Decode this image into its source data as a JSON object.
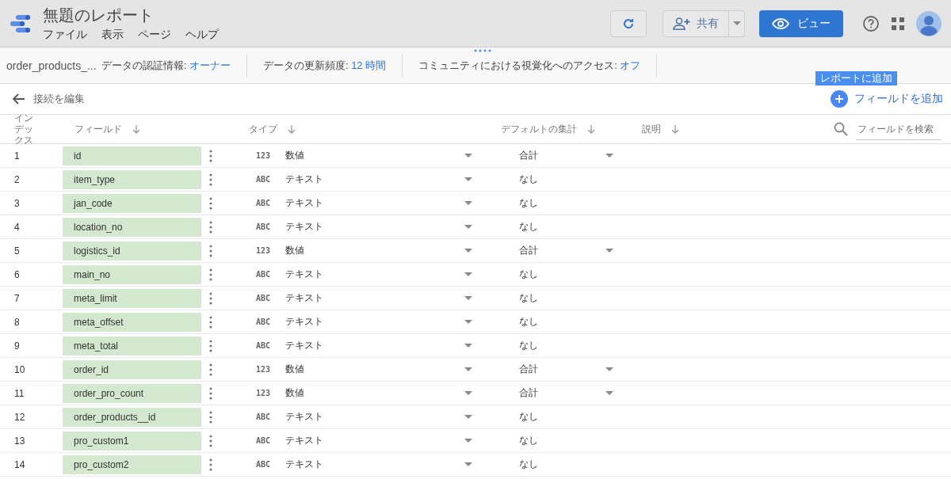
{
  "header": {
    "title": "無題のレポート",
    "menu": [
      "ファイル",
      "表示",
      "ページ",
      "ヘルプ"
    ],
    "share_label": "共有",
    "view_label": "ビュー"
  },
  "info_bar": {
    "source": "order_products_...",
    "items": [
      {
        "label": "データの認証情報:",
        "value": "オーナー"
      },
      {
        "label": "データの更新頻度:",
        "value": "12 時間"
      },
      {
        "label": "コミュニティにおける視覚化へのアクセス:",
        "value": "オフ"
      }
    ]
  },
  "tooltip": "レポートに追加",
  "edit_bar": {
    "back_label": "接続を編集",
    "add_field_label": "フィールドを追加"
  },
  "table": {
    "columns": [
      "インデックス",
      "フィールド",
      "タイプ",
      "デフォルトの集計",
      "説明"
    ],
    "search_placeholder": "フィールドを検索",
    "rows": [
      {
        "index": "1",
        "field": "id",
        "type_icon": "123",
        "type": "数値",
        "aggregation": "合計",
        "aggregation_menu": true
      },
      {
        "index": "2",
        "field": "item_type",
        "type_icon": "ABC",
        "type": "テキスト",
        "aggregation": "なし",
        "aggregation_menu": false
      },
      {
        "index": "3",
        "field": "jan_code",
        "type_icon": "ABC",
        "type": "テキスト",
        "aggregation": "なし",
        "aggregation_menu": false
      },
      {
        "index": "4",
        "field": "location_no",
        "type_icon": "ABC",
        "type": "テキスト",
        "aggregation": "なし",
        "aggregation_menu": false
      },
      {
        "index": "5",
        "field": "logistics_id",
        "type_icon": "123",
        "type": "数値",
        "aggregation": "合計",
        "aggregation_menu": true
      },
      {
        "index": "6",
        "field": "main_no",
        "type_icon": "ABC",
        "type": "テキスト",
        "aggregation": "なし",
        "aggregation_menu": false
      },
      {
        "index": "7",
        "field": "meta_limit",
        "type_icon": "ABC",
        "type": "テキスト",
        "aggregation": "なし",
        "aggregation_menu": false
      },
      {
        "index": "8",
        "field": "meta_offset",
        "type_icon": "ABC",
        "type": "テキスト",
        "aggregation": "なし",
        "aggregation_menu": false
      },
      {
        "index": "9",
        "field": "meta_total",
        "type_icon": "ABC",
        "type": "テキスト",
        "aggregation": "なし",
        "aggregation_menu": false
      },
      {
        "index": "10",
        "field": "order_id",
        "type_icon": "123",
        "type": "数値",
        "aggregation": "合計",
        "aggregation_menu": true
      },
      {
        "index": "11",
        "field": "order_pro_count",
        "type_icon": "123",
        "type": "数値",
        "aggregation": "合計",
        "aggregation_menu": true
      },
      {
        "index": "12",
        "field": "order_products__id",
        "type_icon": "ABC",
        "type": "テキスト",
        "aggregation": "なし",
        "aggregation_menu": false
      },
      {
        "index": "13",
        "field": "pro_custom1",
        "type_icon": "ABC",
        "type": "テキスト",
        "aggregation": "なし",
        "aggregation_menu": false
      },
      {
        "index": "14",
        "field": "pro_custom2",
        "type_icon": "ABC",
        "type": "テキスト",
        "aggregation": "なし",
        "aggregation_menu": false
      }
    ]
  }
}
